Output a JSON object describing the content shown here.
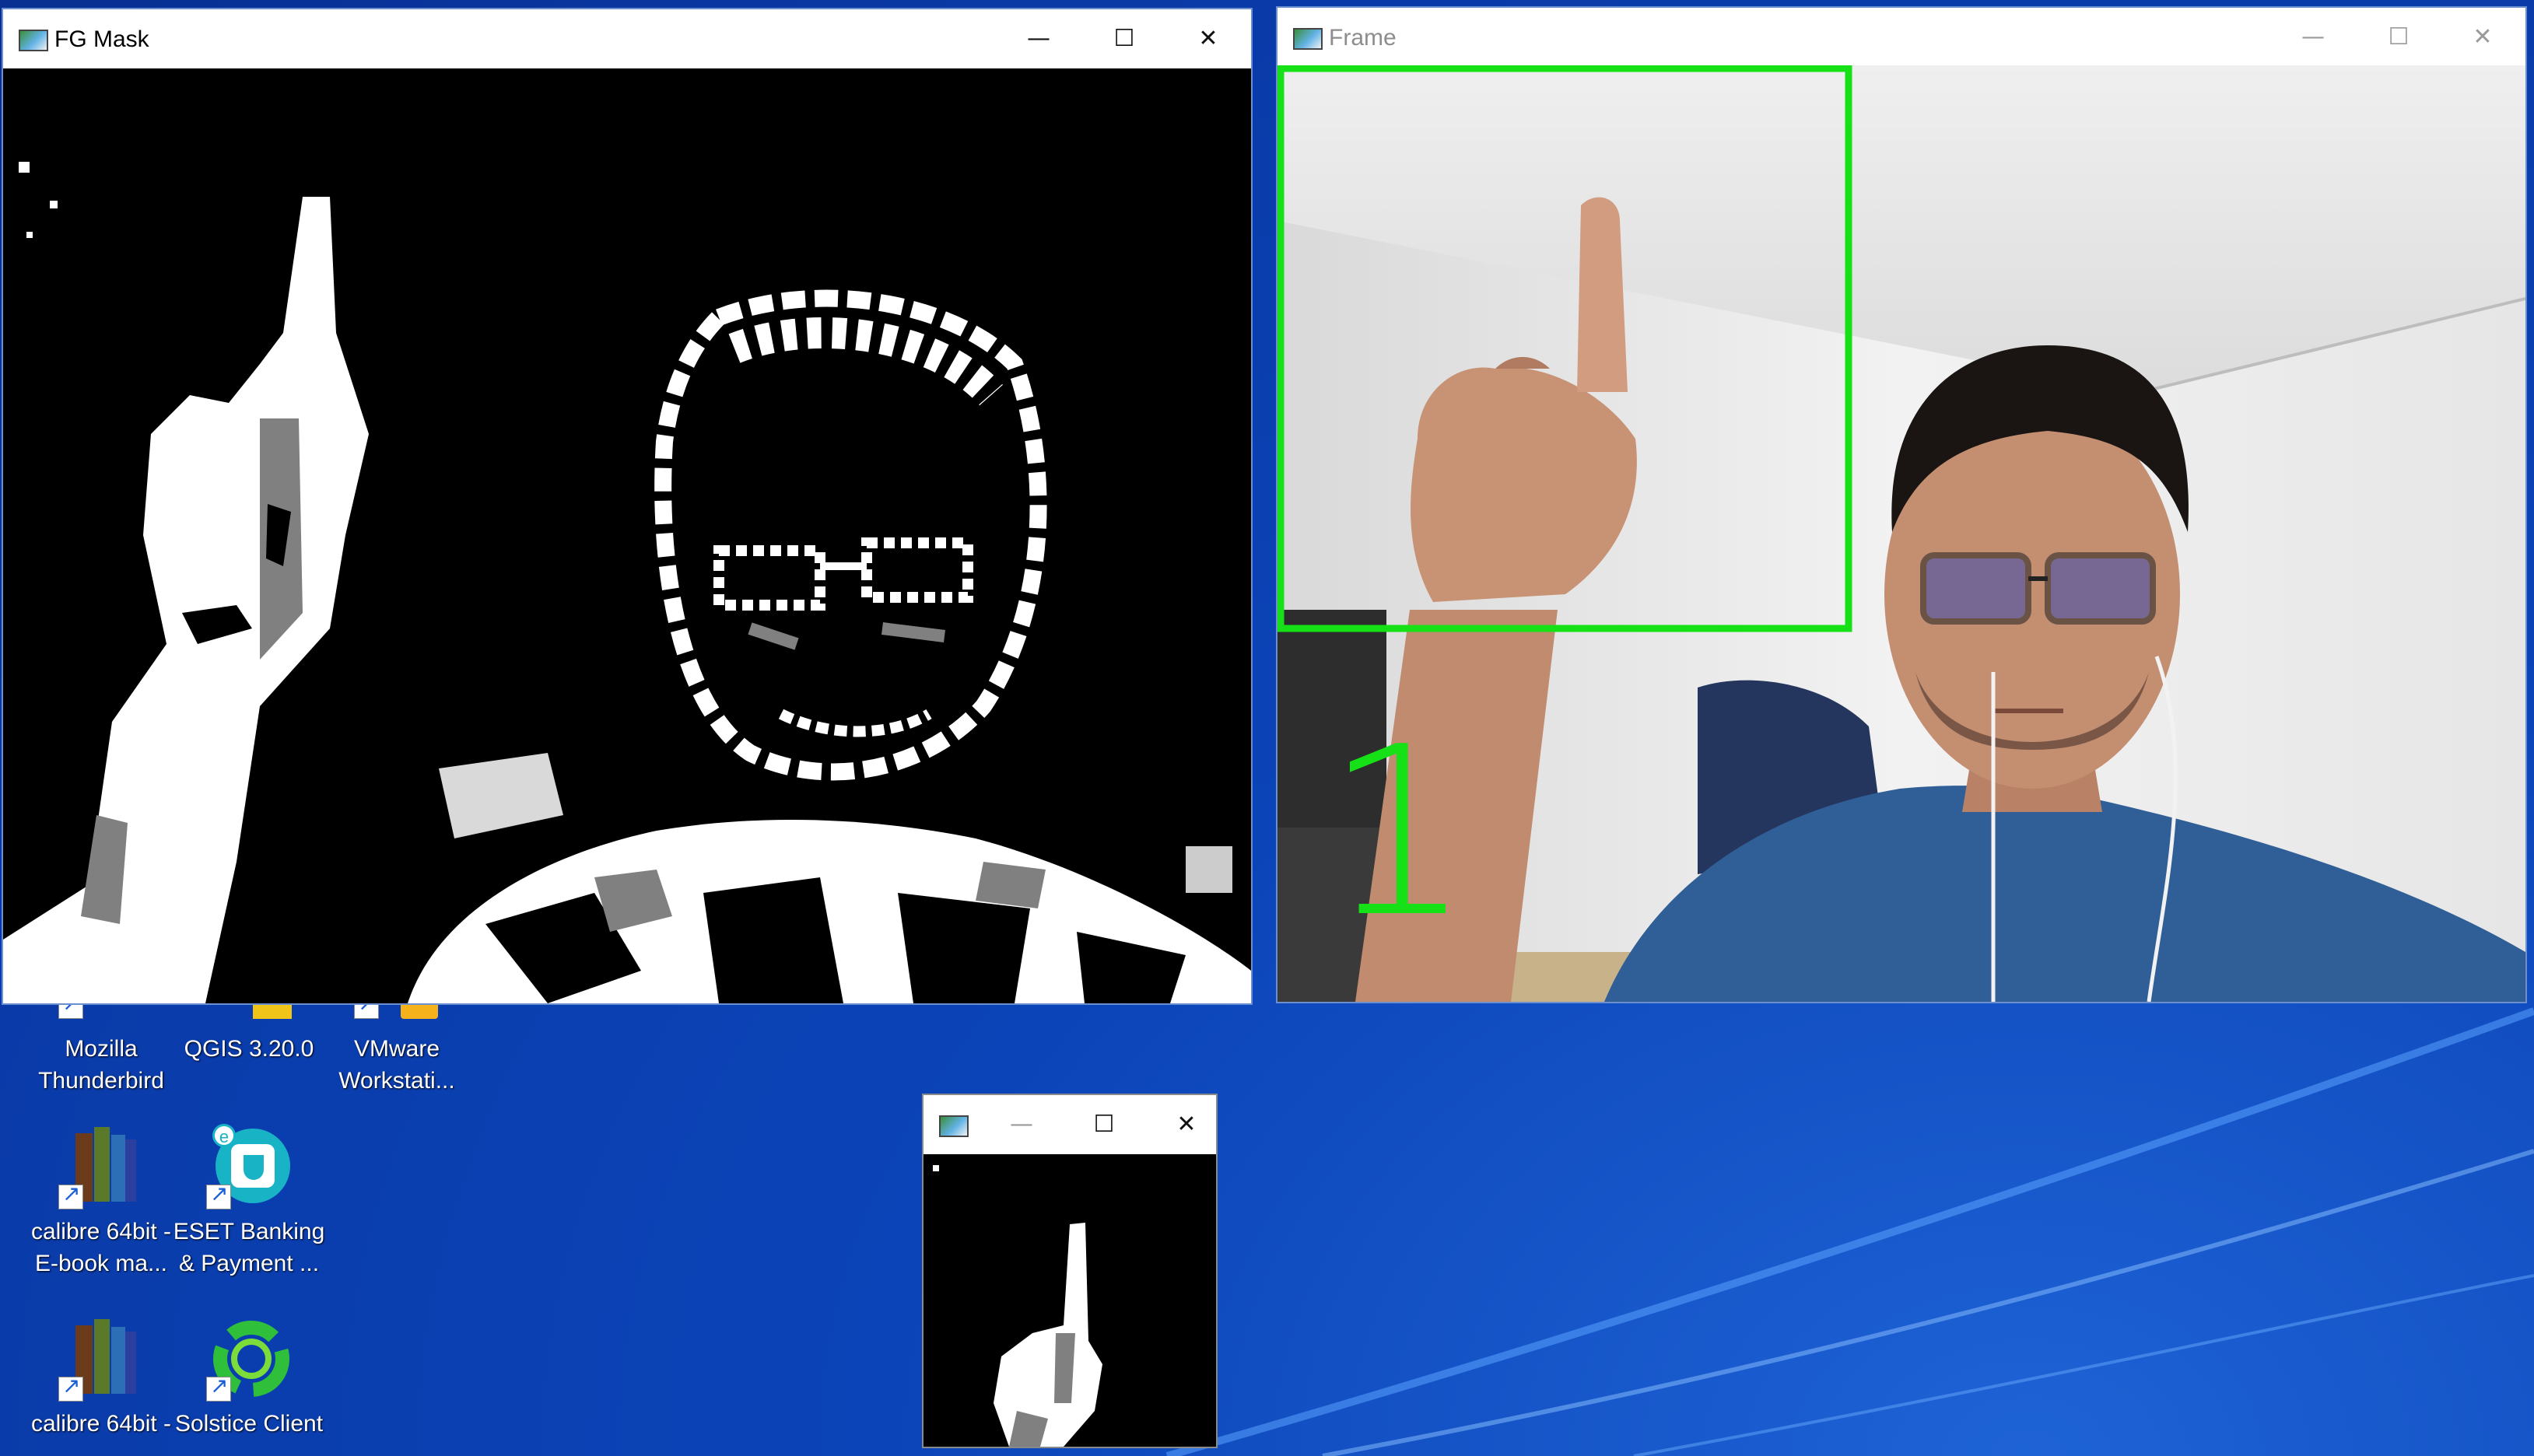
{
  "windows": {
    "fgmask": {
      "title": "FG Mask",
      "min_icon": "minimize-icon",
      "max_icon": "maximize-icon",
      "close_icon": "close-icon"
    },
    "frame": {
      "title": "Frame",
      "detected_count": "1",
      "roi_color": "#16e016"
    },
    "roi": {
      "title": ""
    }
  },
  "desktop": {
    "icons": [
      {
        "label1": "Mozilla",
        "label2": "Thunderbird",
        "icon": "thunderbird-icon"
      },
      {
        "label1": "QGIS 3.20.0",
        "label2": "",
        "icon": "qgis-icon"
      },
      {
        "label1": "VMware",
        "label2": "Workstati...",
        "icon": "vmware-icon"
      },
      {
        "label1": "calibre 64bit -",
        "label2": "E-book ma...",
        "icon": "calibre-icon"
      },
      {
        "label1": "ESET Banking",
        "label2": "& Payment ...",
        "icon": "eset-icon"
      },
      {
        "label1": "calibre 64bit -",
        "label2": "",
        "icon": "calibre-icon"
      },
      {
        "label1": "Solstice Client",
        "label2": "",
        "icon": "solstice-icon"
      }
    ]
  },
  "colors": {
    "desktop_blue": "#0b44b8",
    "mask_white": "#ffffff",
    "mask_gray": "#808080",
    "mask_black": "#000000"
  }
}
